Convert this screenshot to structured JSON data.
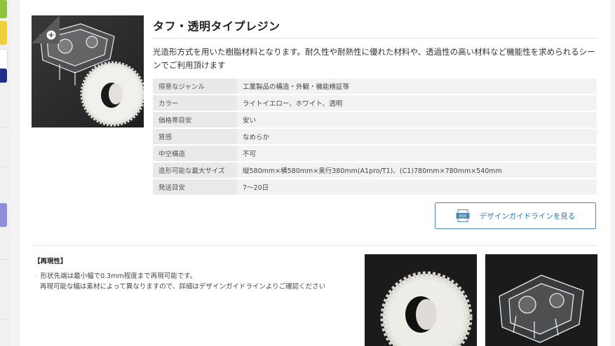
{
  "product": {
    "title": "タフ・透明タイプレジン",
    "description": "光造形方式を用いた樹脂材料となります。耐久性や耐熱性に優れた材料や、透過性の高い材料など機能性を求められるシーンでご利用頂けます"
  },
  "specs": [
    {
      "label": "得意なジャンル",
      "value": "工業製品の構造・外観・機能検証等"
    },
    {
      "label": "カラー",
      "value": "ライトイエロー、ホワイト、透明"
    },
    {
      "label": "価格帯目安",
      "value": "安い"
    },
    {
      "label": "質感",
      "value": "なめらか"
    },
    {
      "label": "中空構造",
      "value": "不可"
    },
    {
      "label": "造形可能な最大サイズ",
      "value": "縦580mm×横580mm×奥行380mm(A1pro/T1)、(C1)780mm×780mm×540mm"
    },
    {
      "label": "発送目安",
      "value": "7〜20日"
    }
  ],
  "guide_button": {
    "label": "デザインガイドラインを見る",
    "icon": "pdf-icon"
  },
  "reproducibility": {
    "heading": "【再現性】",
    "line1": "形状先端は最小幅で0.3mm程度まで再現可能です。",
    "line2": "再現可能な幅は素材によって異なりますので、詳細はデザインガイドラインよりご確認ください"
  },
  "icons": {
    "zoom": "zoom-plus-icon",
    "pdf": "pdf-icon"
  },
  "colors": {
    "accent": "#2f78ad",
    "accent_border": "#4a8ab7"
  }
}
